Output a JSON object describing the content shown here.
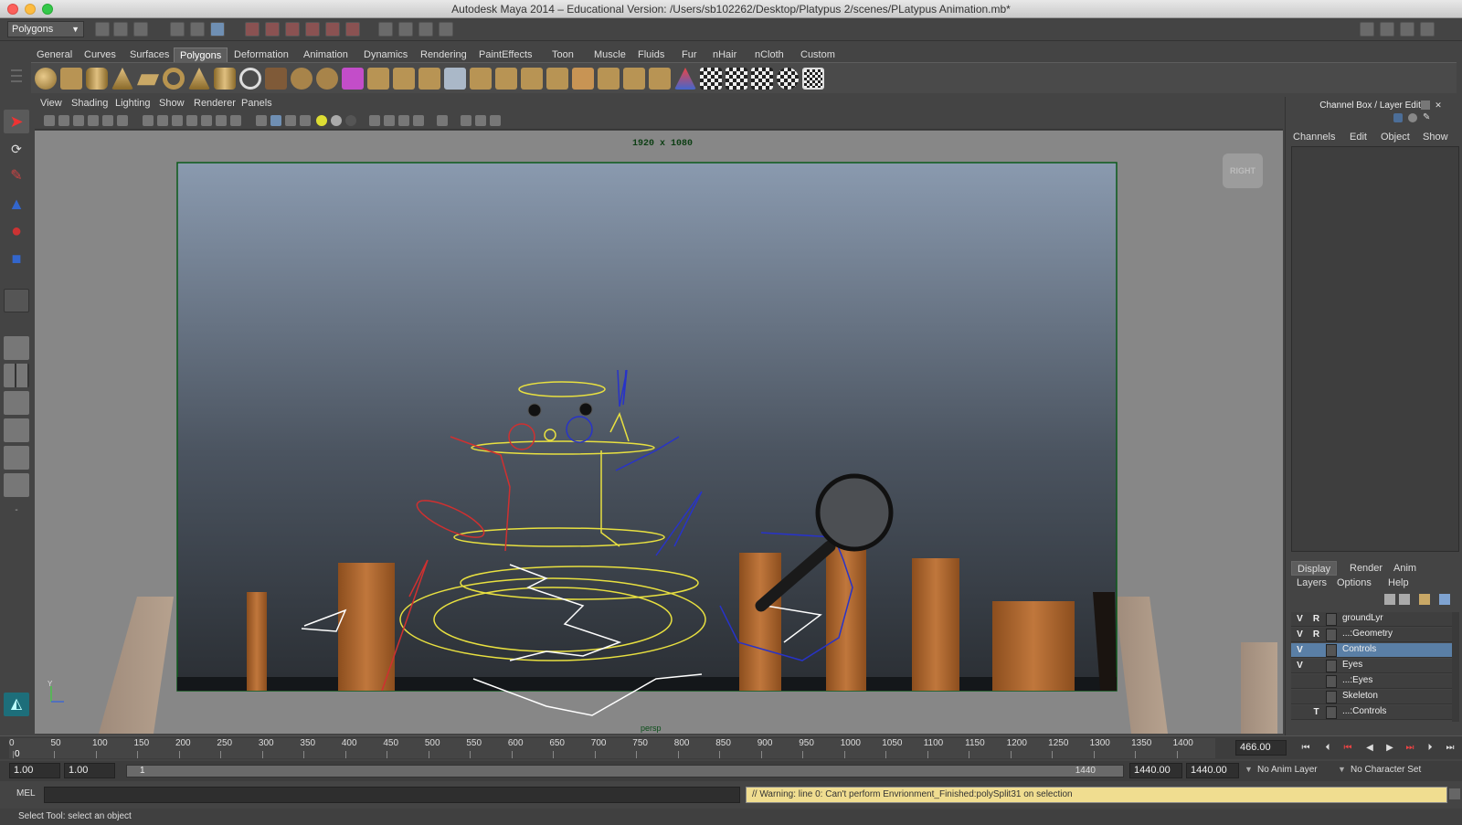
{
  "window": {
    "title": "Autodesk Maya 2014 – Educational Version: /Users/sb102262/Desktop/Platypus 2/scenes/PLatypus Animation.mb*"
  },
  "statusline": {
    "mode": "Polygons"
  },
  "shelf": {
    "tabs": [
      "General",
      "Curves",
      "Surfaces",
      "Polygons",
      "Deformation",
      "Animation",
      "Dynamics",
      "Rendering",
      "PaintEffects",
      "Toon",
      "Muscle",
      "Fluids",
      "Fur",
      "nHair",
      "nCloth",
      "Custom"
    ],
    "active": "Polygons"
  },
  "viewport": {
    "menus": [
      "View",
      "Shading",
      "Lighting",
      "Show",
      "Renderer",
      "Panels"
    ],
    "gate_label": "1920 x 1080",
    "viewcube": "RIGHT",
    "camera": "persp"
  },
  "channel_box": {
    "title": "Channel Box / Layer Editor",
    "menus": [
      "Channels",
      "Edit",
      "Object",
      "Show"
    ]
  },
  "layer_editor": {
    "tabs": [
      "Display",
      "Render",
      "Anim"
    ],
    "active_tab": "Display",
    "menus": [
      "Layers",
      "Options",
      "Help"
    ],
    "layers": [
      {
        "v": "V",
        "r": "R",
        "name": "groundLyr",
        "selected": false
      },
      {
        "v": "V",
        "r": "R",
        "name": "...:Geometry",
        "selected": false
      },
      {
        "v": "V",
        "r": "",
        "name": "Controls",
        "selected": true
      },
      {
        "v": "V",
        "r": "",
        "name": "Eyes",
        "selected": false
      },
      {
        "v": "",
        "r": "",
        "name": "...:Eyes",
        "selected": false
      },
      {
        "v": "",
        "r": "",
        "name": "Skeleton",
        "selected": false
      },
      {
        "v": "",
        "r": "T",
        "name": "...:Controls",
        "selected": false
      }
    ]
  },
  "timeslider": {
    "ticks": [
      "0",
      "50",
      "100",
      "150",
      "200",
      "250",
      "300",
      "350",
      "400",
      "450",
      "500",
      "550",
      "600",
      "650",
      "700",
      "750",
      "800",
      "850",
      "900",
      "950",
      "1000",
      "1050",
      "1100",
      "1150",
      "1200",
      "1250",
      "1300",
      "1350",
      "1400"
    ],
    "current_frame_marker": "0",
    "current_time": "466.00"
  },
  "rangeslider": {
    "start": "1.00",
    "playback_start": "1.00",
    "range_start_label": "1",
    "range_end_label": "1440",
    "playback_end": "1440.00",
    "end": "1440.00",
    "anim_layer": "No Anim Layer",
    "character_set": "No Character Set"
  },
  "cmdline": {
    "label": "MEL",
    "result": "// Warning: line 0: Can't perform Envrionment_Finished:polySplit31 on selection"
  },
  "helpline": {
    "text": "Select Tool: select an object"
  }
}
